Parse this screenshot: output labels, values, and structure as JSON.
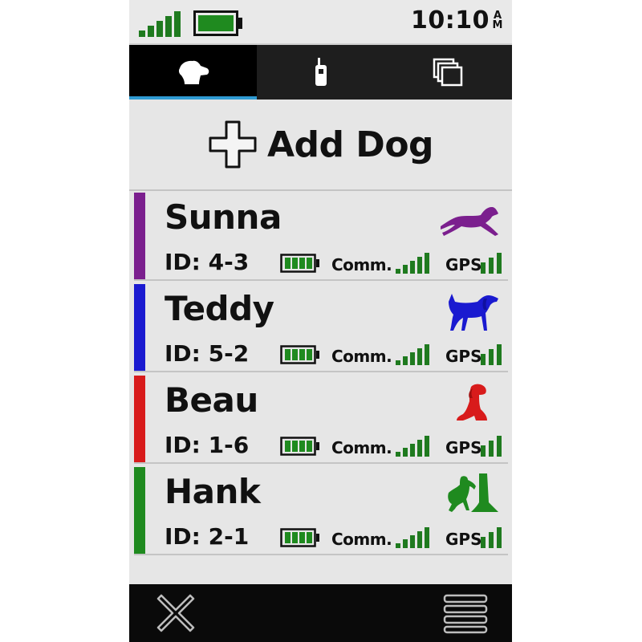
{
  "status_bar": {
    "time": "10:10",
    "ampm_top": "A",
    "ampm_bottom": "M",
    "icons": [
      "signal-strength-icon",
      "battery-icon"
    ]
  },
  "tabs": [
    {
      "name": "dogs",
      "icon": "dog-head-icon",
      "active": true
    },
    {
      "name": "handhelds",
      "icon": "handheld-radio-icon",
      "active": false
    },
    {
      "name": "pages",
      "icon": "stacked-pages-icon",
      "active": false
    }
  ],
  "colors": {
    "accent_underline": "#2f9bd3",
    "battery_green": "#1f8a1f",
    "signal_green": "#1f7a1f"
  },
  "add_dog": {
    "label": "Add Dog",
    "icon": "plus-icon"
  },
  "dogs": [
    {
      "name": "Sunna",
      "id": "ID: 4-3",
      "color": "#7b1f8e",
      "icon": "running-dog-icon",
      "comm": "Comm.",
      "gps": "GPS"
    },
    {
      "name": "Teddy",
      "id": "ID: 5-2",
      "color": "#1a1ad0",
      "icon": "pointing-dog-icon",
      "comm": "Comm.",
      "gps": "GPS"
    },
    {
      "name": "Beau",
      "id": "ID: 1-6",
      "color": "#d81b1b",
      "icon": "sitting-dog-icon",
      "comm": "Comm.",
      "gps": "GPS"
    },
    {
      "name": "Hank",
      "id": "ID: 2-1",
      "color": "#1f8a1f",
      "icon": "treed-dog-icon",
      "comm": "Comm.",
      "gps": "GPS"
    }
  ],
  "bottom_bar": {
    "close_icon": "close-icon",
    "menu_icon": "menu-icon"
  }
}
